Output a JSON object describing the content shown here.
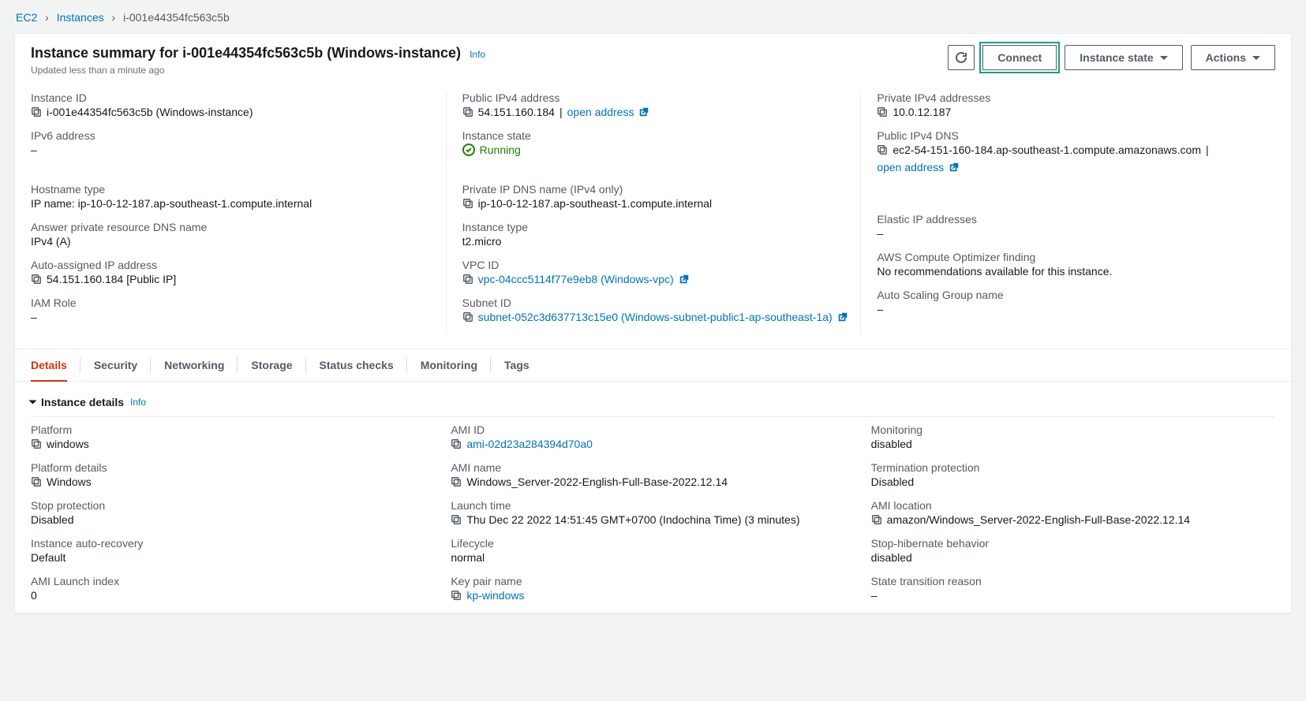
{
  "breadcrumb": {
    "root": "EC2",
    "mid": "Instances",
    "leaf": "i-001e44354fc563c5b"
  },
  "header": {
    "title": "Instance summary for i-001e44354fc563c5b (Windows-instance)",
    "info": "Info",
    "subtitle": "Updated less than a minute ago",
    "connect": "Connect",
    "instance_state": "Instance state",
    "actions": "Actions"
  },
  "summary": {
    "c1": {
      "instance_id_label": "Instance ID",
      "instance_id_value": "i-001e44354fc563c5b (Windows-instance)",
      "ipv6_label": "IPv6 address",
      "ipv6_value": "–",
      "hostname_type_label": "Hostname type",
      "hostname_type_value": "IP name: ip-10-0-12-187.ap-southeast-1.compute.internal",
      "answer_dns_label": "Answer private resource DNS name",
      "answer_dns_value": "IPv4 (A)",
      "auto_ip_label": "Auto-assigned IP address",
      "auto_ip_value": "54.151.160.184 [Public IP]",
      "iam_label": "IAM Role",
      "iam_value": "–"
    },
    "c2": {
      "pub_ip_label": "Public IPv4 address",
      "pub_ip_value": "54.151.160.184",
      "open_address": "open address",
      "state_label": "Instance state",
      "state_value": "Running",
      "priv_dns_label": "Private IP DNS name (IPv4 only)",
      "priv_dns_value": "ip-10-0-12-187.ap-southeast-1.compute.internal",
      "type_label": "Instance type",
      "type_value": "t2.micro",
      "vpc_label": "VPC ID",
      "vpc_value": "vpc-04ccc5114f77e9eb8 (Windows-vpc)",
      "subnet_label": "Subnet ID",
      "subnet_value": "subnet-052c3d637713c15e0 (Windows-subnet-public1-ap-southeast-1a)"
    },
    "c3": {
      "priv_ip_label": "Private IPv4 addresses",
      "priv_ip_value": "10.0.12.187",
      "pub_dns_label": "Public IPv4 DNS",
      "pub_dns_value": "ec2-54-151-160-184.ap-southeast-1.compute.amazonaws.com",
      "open_address": "open address",
      "eip_label": "Elastic IP addresses",
      "eip_value": "–",
      "optimizer_label": "AWS Compute Optimizer finding",
      "optimizer_value": "No recommendations available for this instance.",
      "asg_label": "Auto Scaling Group name",
      "asg_value": "–"
    }
  },
  "tabs": {
    "details": "Details",
    "security": "Security",
    "networking": "Networking",
    "storage": "Storage",
    "status_checks": "Status checks",
    "monitoring": "Monitoring",
    "tags": "Tags"
  },
  "details": {
    "section_title": "Instance details",
    "info": "Info",
    "c1": {
      "platform_label": "Platform",
      "platform_value": "windows",
      "platform_details_label": "Platform details",
      "platform_details_value": "Windows",
      "stop_protection_label": "Stop protection",
      "stop_protection_value": "Disabled",
      "auto_recovery_label": "Instance auto-recovery",
      "auto_recovery_value": "Default",
      "ami_launch_label": "AMI Launch index",
      "ami_launch_value": "0"
    },
    "c2": {
      "ami_id_label": "AMI ID",
      "ami_id_value": "ami-02d23a284394d70a0",
      "ami_name_label": "AMI name",
      "ami_name_value": "Windows_Server-2022-English-Full-Base-2022.12.14",
      "launch_time_label": "Launch time",
      "launch_time_value": "Thu Dec 22 2022 14:51:45 GMT+0700 (Indochina Time) (3 minutes)",
      "lifecycle_label": "Lifecycle",
      "lifecycle_value": "normal",
      "keypair_label": "Key pair name",
      "keypair_value": "kp-windows"
    },
    "c3": {
      "monitoring_label": "Monitoring",
      "monitoring_value": "disabled",
      "term_protect_label": "Termination protection",
      "term_protect_value": "Disabled",
      "ami_location_label": "AMI location",
      "ami_location_value": "amazon/Windows_Server-2022-English-Full-Base-2022.12.14",
      "stop_hibernate_label": "Stop-hibernate behavior",
      "stop_hibernate_value": "disabled",
      "state_reason_label": "State transition reason",
      "state_reason_value": "–"
    }
  }
}
